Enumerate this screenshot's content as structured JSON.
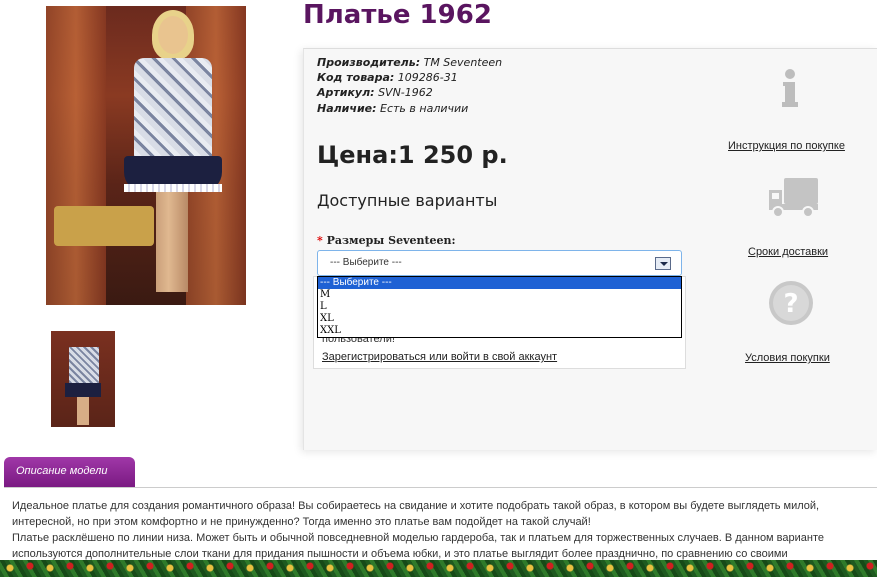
{
  "product": {
    "title": "Платье 1962",
    "manufacturer_label": "Производитель:",
    "manufacturer": "ТМ Seventeen",
    "code_label": "Код товара:",
    "code": "109286-31",
    "article_label": "Артикул:",
    "article": "SVN-1962",
    "availability_label": "Наличие:",
    "availability": "Есть в наличии",
    "price": "Цена:1 250 р."
  },
  "options": {
    "heading": "Доступные варианты",
    "required_mark": "*",
    "size_label": "Размеры Seventeen:",
    "selected": "--- Выберите ---",
    "items": [
      "--- Выберите ---",
      "M",
      "L",
      "XL",
      "XXL"
    ]
  },
  "login_note": {
    "partial_text": "пользователи!",
    "register_link": "Зарегистрироваться или войти в свой аккаунт"
  },
  "side_links": {
    "instructions": "Инструкция по покупке",
    "delivery": "Сроки доставки",
    "terms": "Условия покупки"
  },
  "description": {
    "tab_label": "Описание модели",
    "lines": [
      "Идеальное платье для создания романтичного образа! Вы собираетесь на свидание и хотите подобрать такой образ, в котором вы будете выглядеть милой,",
      "интересной, но при этом комфортно и не принужденно? Тогда именно это платье вам подойдет на такой случай!",
      "Платье расклёшено по линии низа. Может быть и обычной повседневной моделью гардероба, так и платьем для торжественных случаев. В данном варианте",
      "используются дополнительные слои ткани для придания пышности и объема юбки, и это платье выглядит более празднично, по сравнению со своими"
    ]
  },
  "colors": {
    "title": "#5a1560",
    "tab": "#8a2a92",
    "dropdown_selected": "#1e61d4",
    "required": "#dd0000"
  },
  "icons": {
    "instructions": "info-icon",
    "delivery": "truck-icon",
    "terms": "question-icon"
  }
}
